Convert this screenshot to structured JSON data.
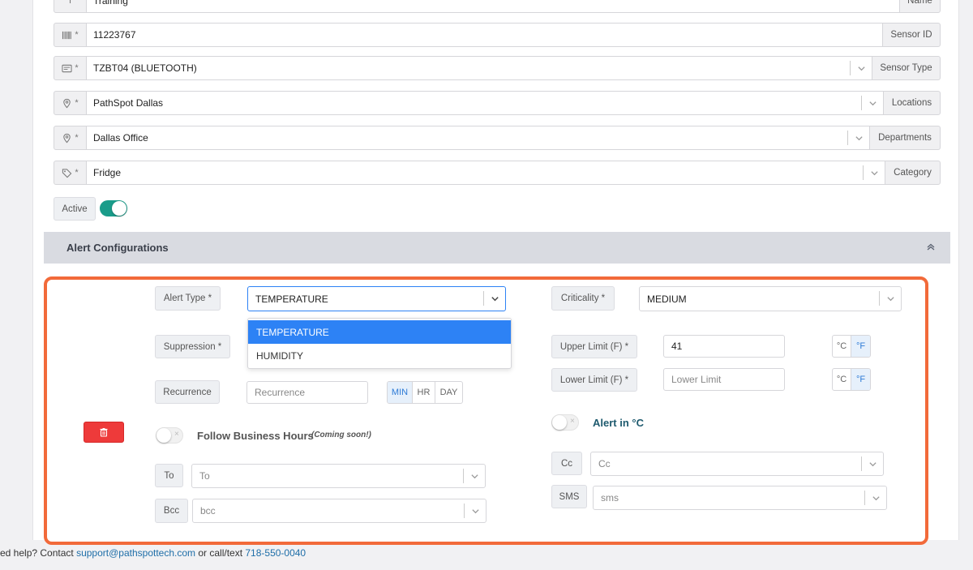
{
  "form": {
    "name": {
      "value": "Training",
      "suffix": "Name"
    },
    "sensor_id": {
      "value": "11223767",
      "suffix": "Sensor ID"
    },
    "sensor_type": {
      "value": "TZBT04 (BLUETOOTH)",
      "suffix": "Sensor Type"
    },
    "location": {
      "value": "PathSpot Dallas",
      "suffix": "Locations"
    },
    "department": {
      "value": "Dallas Office",
      "suffix": "Departments"
    },
    "category": {
      "value": "Fridge",
      "suffix": "Category"
    },
    "required_mark": "*",
    "active": {
      "label": "Active",
      "on": true
    }
  },
  "alert_section": {
    "title": "Alert Configurations",
    "alert_type": {
      "label": "Alert Type *",
      "value": "TEMPERATURE",
      "options": [
        "TEMPERATURE",
        "HUMIDITY"
      ]
    },
    "criticality": {
      "label": "Criticality *",
      "value": "MEDIUM"
    },
    "suppression": {
      "label": "Suppression *"
    },
    "upper_limit": {
      "label": "Upper Limit (F) *",
      "value": "41"
    },
    "lower_limit": {
      "label": "Lower Limit (F) *",
      "placeholder": "Lower Limit"
    },
    "units": {
      "c": "°C",
      "f": "°F"
    },
    "recurrence": {
      "label": "Recurrence",
      "placeholder": "Recurrence",
      "units": [
        "MIN",
        "HR",
        "DAY"
      ],
      "selected": "MIN"
    },
    "follow_business_hours": {
      "label": "Follow Business Hours",
      "note": "(Coming soon!)",
      "on": false
    },
    "alert_in_c": {
      "label": "Alert in °C",
      "on": false
    },
    "to": {
      "label": "To",
      "placeholder": "To"
    },
    "bcc": {
      "label": "Bcc",
      "placeholder": "bcc"
    },
    "cc": {
      "label": "Cc",
      "placeholder": "Cc"
    },
    "sms": {
      "label": "SMS",
      "placeholder": "sms"
    }
  },
  "footer": {
    "prefix": "ed help? Contact ",
    "email": "support@pathspottech.com",
    "middle": " or call/text ",
    "phone": "718-550-0040"
  },
  "colors": {
    "accent": "#2d82f5",
    "highlight_border": "#f26a3a",
    "toggle_on": "#1a9c8a",
    "delete": "#ee3a3a"
  }
}
